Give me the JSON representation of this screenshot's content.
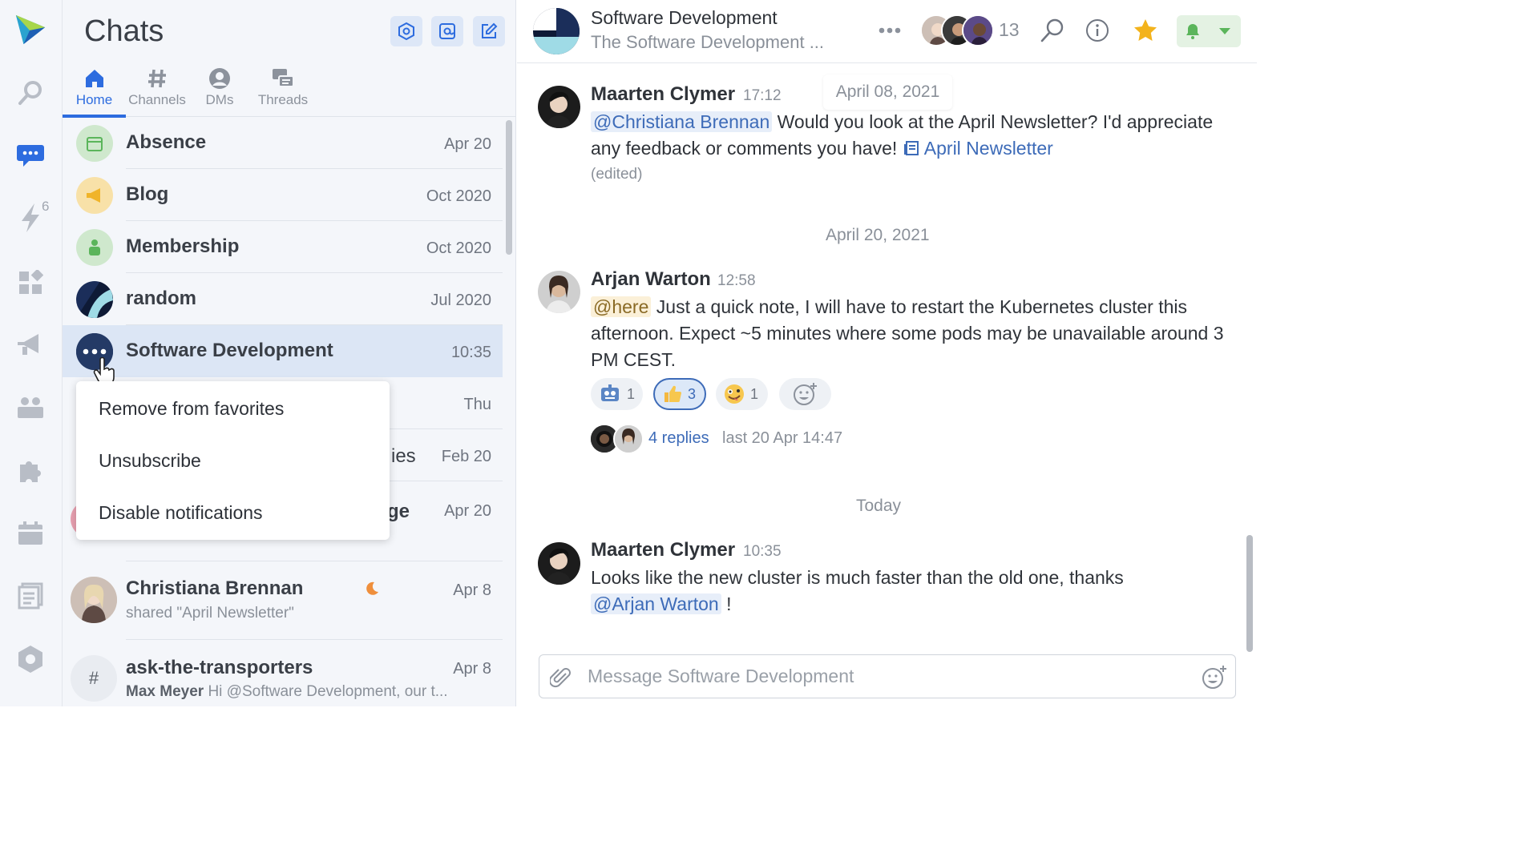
{
  "sidebar": {
    "flash_badge": "6"
  },
  "chats_panel": {
    "title": "Chats",
    "tabs": [
      {
        "label": "Home"
      },
      {
        "label": "Channels"
      },
      {
        "label": "DMs"
      },
      {
        "label": "Threads"
      }
    ],
    "rows": [
      {
        "name": "Absence",
        "time": "Apr 20"
      },
      {
        "name": "Blog",
        "time": "Oct 2020"
      },
      {
        "name": "Membership",
        "time": "Oct 2020"
      },
      {
        "name": "random",
        "time": "Jul 2020"
      },
      {
        "name": "Software Development",
        "time": "10:35"
      },
      {
        "time": "Thu"
      },
      {
        "name_fragment": "ies",
        "time": "Feb 20"
      },
      {
        "name_fragment": "ge",
        "time": "Apr 20"
      },
      {
        "name": "Christiana Brennan",
        "subtitle": "shared \"April Newsletter\"",
        "time": "Apr 8"
      },
      {
        "name": "ask-the-transporters",
        "subtitle_author": "Max Meyer",
        "subtitle": "Hi @Software Development, our t...",
        "time": "Apr 8"
      }
    ],
    "context_menu": [
      "Remove from favorites",
      "Unsubscribe",
      "Disable notifications"
    ]
  },
  "chat": {
    "title": "Software Development",
    "topic": "The Software Development ...",
    "member_count": "13",
    "date_pill": "April 08, 2021",
    "messages": [
      {
        "author": "Maarten Clymer",
        "time": "17:12",
        "mention": "@Christiana Brennan",
        "text": " Would you look at the April Newsletter? I'd appreciate any feedback or comments you have! ",
        "link": "April Newsletter",
        "edited": "(edited)"
      },
      {
        "date_separator": "April 20, 2021",
        "author": "Arjan Warton",
        "time": "12:58",
        "mention": "@here",
        "text": " Just a quick note, I will have to restart the Kubernetes cluster this afternoon. Expect ~5 minutes where some pods may be unavailable around 3 PM CEST.",
        "reactions": [
          {
            "emoji": "robot",
            "count": "1"
          },
          {
            "emoji": "thumbs-up",
            "count": "3"
          },
          {
            "emoji": "zany-face",
            "count": "1"
          }
        ],
        "replies": "4 replies",
        "last_reply": "last 20 Apr 14:47"
      },
      {
        "date_separator": "Today",
        "author": "Maarten Clymer",
        "time": "10:35",
        "text": "Looks like the new cluster is much faster than the old one, thanks ",
        "mention": "@Arjan Warton",
        "text_after": " !"
      }
    ],
    "input_placeholder": "Message Software Development"
  },
  "colors": {
    "accent": "#2d6cdf",
    "star": "#f3b31c",
    "bell": "#5bb55b",
    "sidebar_bg": "#f4f6fa"
  }
}
